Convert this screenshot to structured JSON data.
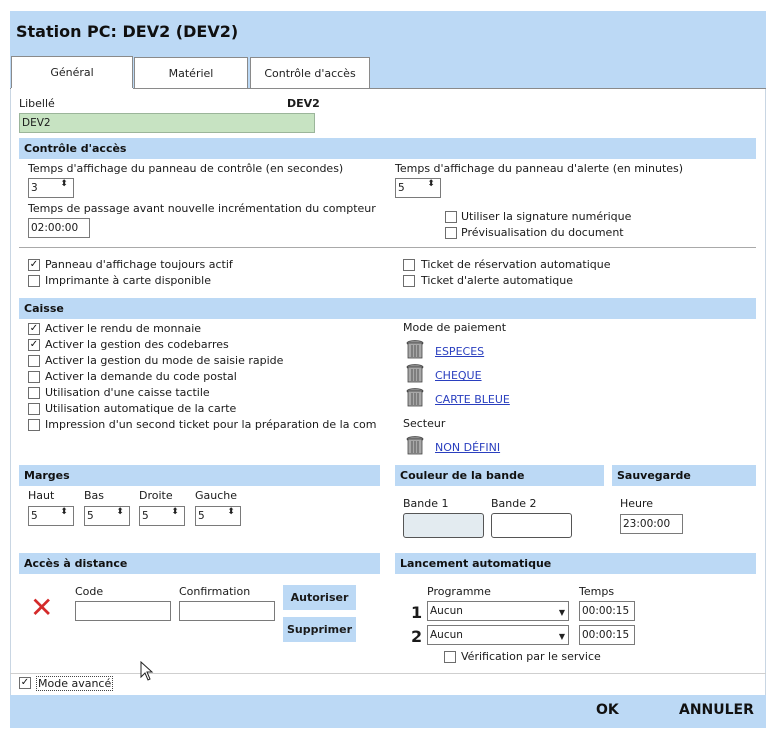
{
  "window": {
    "title": "Station PC: DEV2 (DEV2)"
  },
  "tabs": [
    {
      "label": "Général"
    },
    {
      "label": "Matériel"
    },
    {
      "label": "Contrôle d'accès"
    }
  ],
  "libelle": {
    "label": "Libellé",
    "tag": "DEV2",
    "value": "DEV2"
  },
  "controle": {
    "section": "Contrôle d'accès",
    "panel_time_label": "Temps d'affichage du panneau de contrôle (en secondes)",
    "panel_time_value": "3",
    "alert_time_label": "Temps d'affichage du panneau d'alerte (en minutes)",
    "alert_time_value": "5",
    "passage_label": "Temps de passage avant nouvelle incrémentation du compteur",
    "passage_value": "02:00:00",
    "signature_label": "Utiliser la signature numérique",
    "preview_label": "Prévisualisation du document",
    "panneau_label": "Panneau d'affichage toujours actif",
    "imprimante_label": "Imprimante à carte disponible",
    "ticket_reservation_label": "Ticket de réservation automatique",
    "ticket_alerte_label": "Ticket d'alerte automatique",
    "check_mark": "✓"
  },
  "caisse": {
    "section": "Caisse",
    "options": [
      "Activer le rendu de monnaie",
      "Activer la gestion des codebarres",
      "Activer la gestion du mode de saisie rapide",
      "Activer la demande du code postal",
      "Utilisation d'une caisse tactile",
      "Utilisation automatique de la carte",
      "Impression d'un second ticket pour la préparation de la com"
    ],
    "checked": [
      true,
      true,
      false,
      false,
      false,
      false,
      false
    ],
    "payment_label": "Mode de paiement",
    "payments": [
      "ESPECES",
      "CHEQUE",
      "CARTE BLEUE"
    ],
    "secteur_label": "Secteur",
    "secteur_value": "NON DÉFINI"
  },
  "marges": {
    "section": "Marges",
    "fields": [
      {
        "label": "Haut",
        "value": "5"
      },
      {
        "label": "Bas",
        "value": "5"
      },
      {
        "label": "Droite",
        "value": "5"
      },
      {
        "label": "Gauche",
        "value": "5"
      }
    ]
  },
  "couleur": {
    "section": "Couleur de la bande",
    "bande1": "Bande 1",
    "bande2": "Bande 2"
  },
  "sauvegarde": {
    "section": "Sauvegarde",
    "heure_label": "Heure",
    "heure_value": "23:00:00"
  },
  "acces": {
    "section": "Accès à distance",
    "code_label": "Code",
    "confirm_label": "Confirmation",
    "autoriser": "Autoriser",
    "supprimer": "Supprimer",
    "status_icon": "✕"
  },
  "lancement": {
    "section": "Lancement automatique",
    "programme_label": "Programme",
    "temps_label": "Temps",
    "rows": [
      {
        "num": "1",
        "programme": "Aucun",
        "temps": "00:00:15"
      },
      {
        "num": "2",
        "programme": "Aucun",
        "temps": "00:00:15"
      }
    ],
    "verification_label": "Vérification par le service"
  },
  "mode_avance": {
    "label": "Mode avancé",
    "checked": true
  },
  "footer": {
    "ok": "OK",
    "annuler": "ANNULER"
  },
  "icons": {
    "spin": "spin-arrows-icon",
    "trash": "trash-bin-icon",
    "dropdown": "dropdown-arrow-icon",
    "cursor": "mouse-cursor-icon"
  },
  "colors": {
    "accent": "#bcd9f5",
    "libelle_bg": "#c7e3c2",
    "link": "#2a3fbf",
    "status_red": "#d42a2a",
    "bande1_bg": "#e3ebf0"
  }
}
